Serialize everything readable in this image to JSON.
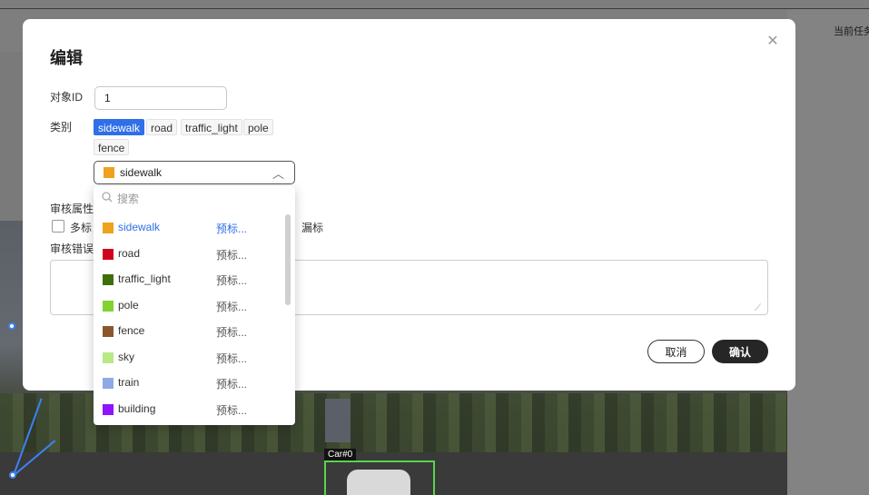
{
  "background": {
    "task_label": "当前任务",
    "car_tag": "Car#0"
  },
  "modal": {
    "title": "编辑",
    "close_icon": "close-icon",
    "object_id_label": "对象ID",
    "object_id_value": "1",
    "category_label": "类别",
    "category_tags": [
      {
        "label": "sidewalk",
        "active": true
      },
      {
        "label": "road",
        "active": false
      },
      {
        "label": "traffic_light",
        "active": false
      },
      {
        "label": "pole",
        "active": false
      },
      {
        "label": "fence",
        "active": false
      }
    ],
    "select": {
      "value": "sidewalk",
      "color": "#f0a11d",
      "chevron_icon": "chevron-up-icon"
    },
    "review_attr_label": "审核属性",
    "review_options": [
      "多标",
      "漏标"
    ],
    "review_error_label": "审核错误",
    "cancel_label": "取消",
    "ok_label": "确认"
  },
  "dropdown": {
    "search_placeholder": "搜索",
    "search_icon": "search-icon",
    "items": [
      {
        "name": "sidewalk",
        "color": "#f0a11d",
        "pre": "预标...",
        "selected": true
      },
      {
        "name": "road",
        "color": "#d0021b",
        "pre": "预标...",
        "selected": false
      },
      {
        "name": "traffic_light",
        "color": "#3f6f0a",
        "pre": "预标...",
        "selected": false
      },
      {
        "name": "pole",
        "color": "#82d232",
        "pre": "预标...",
        "selected": false
      },
      {
        "name": "fence",
        "color": "#8b572a",
        "pre": "预标...",
        "selected": false
      },
      {
        "name": "sky",
        "color": "#b8e986",
        "pre": "预标...",
        "selected": false
      },
      {
        "name": "train",
        "color": "#8fa8e8",
        "pre": "预标...",
        "selected": false
      },
      {
        "name": "building",
        "color": "#9013fe",
        "pre": "预标...",
        "selected": false
      }
    ]
  }
}
